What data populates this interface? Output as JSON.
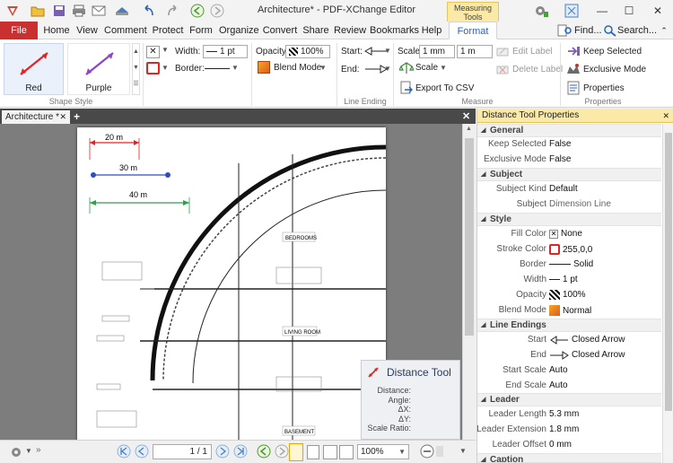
{
  "window": {
    "title": "Architecture* - PDF-XChange Editor",
    "context_tab": "Measuring Tools"
  },
  "tabs": {
    "file": "File",
    "home": "Home",
    "view": "View",
    "comment": "Comment",
    "protect": "Protect",
    "form": "Form",
    "organize": "Organize",
    "convert": "Convert",
    "share": "Share",
    "review": "Review",
    "bookmarks": "Bookmarks",
    "help": "Help",
    "format": "Format",
    "find": "Find...",
    "search": "Search..."
  },
  "ribbon": {
    "shape_style": {
      "red_label": "Red",
      "purple_label": "Purple",
      "group_label": "Shape Style"
    },
    "width_label": "Width:",
    "width_value": "1 pt",
    "border_label": "Border:",
    "opacity_label": "Opacity:",
    "opacity_value": "100%",
    "blend_mode": "Blend Mode",
    "line_ending": {
      "start_label": "Start:",
      "end_label": "End:",
      "group_label": "Line Ending"
    },
    "measure": {
      "scale_label": "Scale:",
      "scale_from": "1 mm",
      "scale_to": "1 m",
      "scale_button": "Scale",
      "export_csv": "Export To CSV",
      "edit_label": "Edit Label",
      "delete_label": "Delete Label",
      "group_label": "Measure"
    },
    "properties": {
      "keep_selected": "Keep Selected",
      "exclusive_mode": "Exclusive Mode",
      "properties": "Properties",
      "group_label": "Properties"
    }
  },
  "document": {
    "tab_label": "Architecture *",
    "dimension_labels": [
      "20 m",
      "30 m",
      "40 m"
    ],
    "room_labels": [
      "BEDROOMS",
      "LIVING ROOM",
      "BASEMENT"
    ]
  },
  "popup": {
    "title": "Distance Tool",
    "fields": [
      "Distance:",
      "Angle:",
      "ΔX:",
      "ΔY:",
      "Scale Ratio:"
    ]
  },
  "statusbar": {
    "page_value": "1 / 1",
    "zoom": "100%"
  },
  "properties_pane": {
    "title": "Distance Tool Properties",
    "sections": [
      {
        "name": "General",
        "rows": [
          {
            "label": "Keep Selected",
            "value": "False"
          },
          {
            "label": "Exclusive Mode",
            "value": "False"
          }
        ]
      },
      {
        "name": "Subject",
        "rows": [
          {
            "label": "Subject Kind",
            "value": "Default"
          },
          {
            "label": "Subject",
            "value": "Dimension Line"
          }
        ]
      },
      {
        "name": "Style",
        "rows": [
          {
            "label": "Fill Color",
            "value": "None"
          },
          {
            "label": "Stroke Color",
            "value": "255,0,0"
          },
          {
            "label": "Border",
            "value": "Solid"
          },
          {
            "label": "Width",
            "value": "1 pt"
          },
          {
            "label": "Opacity",
            "value": "100%"
          },
          {
            "label": "Blend Mode",
            "value": "Normal"
          }
        ]
      },
      {
        "name": "Line Endings",
        "rows": [
          {
            "label": "Start",
            "value": "Closed Arrow"
          },
          {
            "label": "End",
            "value": "Closed Arrow"
          },
          {
            "label": "Start Scale",
            "value": "Auto"
          },
          {
            "label": "End Scale",
            "value": "Auto"
          }
        ]
      },
      {
        "name": "Leader",
        "rows": [
          {
            "label": "Leader Length",
            "value": "5.3 mm"
          },
          {
            "label": "Leader Extension",
            "value": "1.8 mm"
          },
          {
            "label": "Leader Offset",
            "value": "0 mm"
          }
        ]
      },
      {
        "name": "Caption",
        "rows": []
      }
    ]
  },
  "colors": {
    "file_tab": "#c8312f",
    "context_tab": "#fbe9a8",
    "red_line": "#e02424",
    "purple_line": "#8e44c9",
    "blue_line": "#2a4fc0",
    "green_line": "#2ea04a"
  }
}
